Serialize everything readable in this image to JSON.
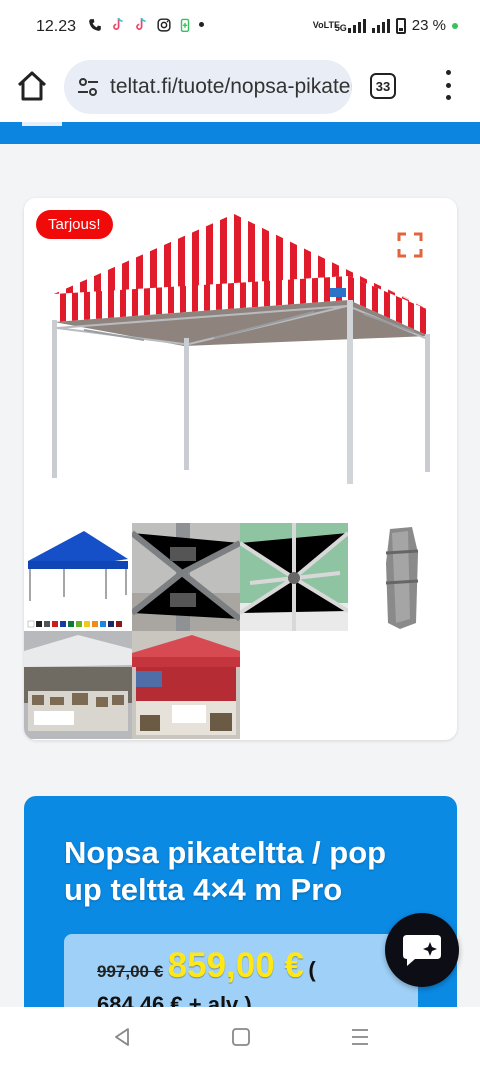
{
  "status": {
    "time": "12.23",
    "icons": [
      "phone-icon",
      "tiktok-icon",
      "tiktok-icon",
      "instagram-icon",
      "battery-saver-icon",
      "dot-icon"
    ],
    "network": "VoLTE",
    "network_5g": "5G",
    "battery_percent": "23 %",
    "battery_level": 0.23
  },
  "browser": {
    "url": "teltat.fi/tuote/nopsa-pikateltta",
    "tab_count": "33"
  },
  "gallery": {
    "sale_badge": "Tarjous!",
    "main_image": "red-white-striped-pop-up-tent",
    "thumbnails": [
      "blue-pop-up-tent-with-color-swatches",
      "tent-frame-joint-closeup",
      "green-canopy-frame-underside",
      "tent-carry-bag",
      "market-stall-tents",
      "red-market-tent-stall"
    ]
  },
  "product": {
    "title": "Nopsa pikateltta / pop up teltta 4×4 m Pro",
    "old_price": "997,00 €",
    "new_price": "859,00 €",
    "vat_price_open": "(",
    "vat_price": "684,46 € + alv )"
  },
  "colors": {
    "brand_blue": "#0b8ae4",
    "sale_red": "#f00a0a",
    "price_yellow": "#ffe816",
    "price_box": "#9fd1f8"
  }
}
